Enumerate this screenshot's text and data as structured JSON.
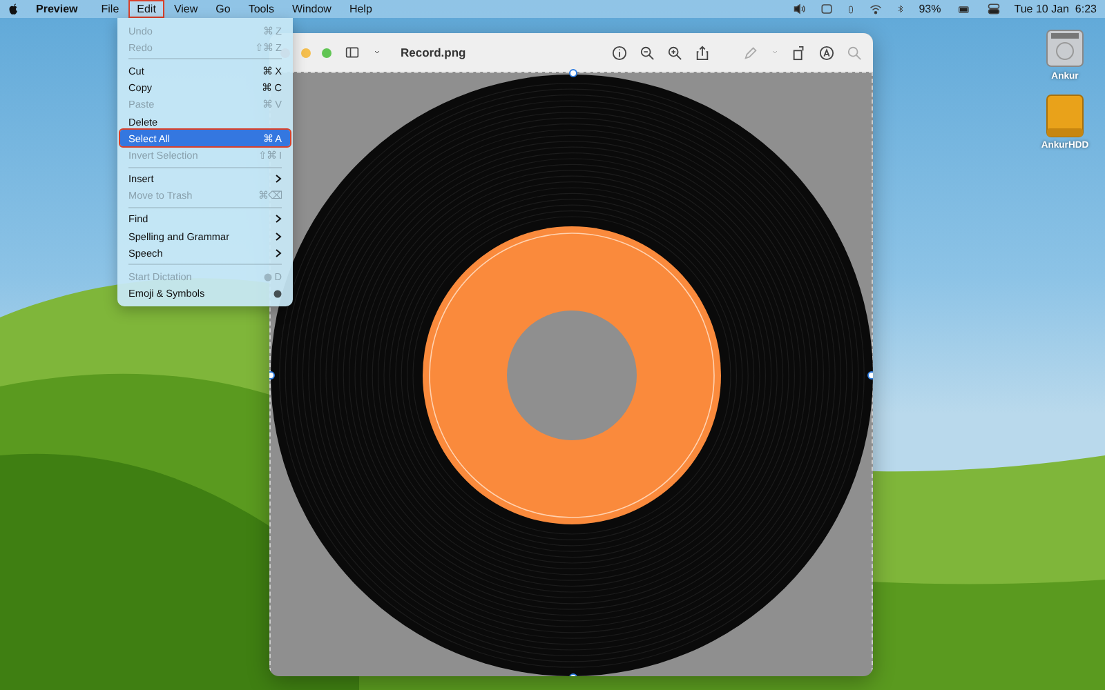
{
  "menubar": {
    "app": "Preview",
    "menus": [
      {
        "label": "File",
        "selected": false
      },
      {
        "label": "Edit",
        "selected": true
      },
      {
        "label": "View",
        "selected": false
      },
      {
        "label": "Go",
        "selected": false
      },
      {
        "label": "Tools",
        "selected": false
      },
      {
        "label": "Window",
        "selected": false
      },
      {
        "label": "Help",
        "selected": false
      }
    ],
    "battery": "93%",
    "clock": "Tue 10 Jan  6:23"
  },
  "edit_menu": [
    {
      "kind": "item",
      "label": "Undo",
      "shortcut": "⌘ Z",
      "disabled": true,
      "selected": false
    },
    {
      "kind": "item",
      "label": "Redo",
      "shortcut": "⇧⌘ Z",
      "disabled": true,
      "selected": false
    },
    {
      "kind": "separator"
    },
    {
      "kind": "item",
      "label": "Cut",
      "shortcut": "⌘ X",
      "disabled": false,
      "selected": false
    },
    {
      "kind": "item",
      "label": "Copy",
      "shortcut": "⌘ C",
      "disabled": false,
      "selected": false
    },
    {
      "kind": "item",
      "label": "Paste",
      "shortcut": "⌘ V",
      "disabled": true,
      "selected": false
    },
    {
      "kind": "item",
      "label": "Delete",
      "disabled": false,
      "selected": false
    },
    {
      "kind": "item",
      "label": "Select All",
      "shortcut": "⌘ A",
      "disabled": false,
      "selected": true
    },
    {
      "kind": "item",
      "label": "Invert Selection",
      "shortcut": "⇧⌘ I",
      "disabled": true,
      "selected": false
    },
    {
      "kind": "separator"
    },
    {
      "kind": "item",
      "label": "Insert",
      "submenu": true,
      "disabled": false,
      "selected": false
    },
    {
      "kind": "item",
      "label": "Move to Trash",
      "shortcut": "⌘⌫",
      "disabled": true,
      "selected": false
    },
    {
      "kind": "separator"
    },
    {
      "kind": "item",
      "label": "Find",
      "submenu": true,
      "disabled": false,
      "selected": false
    },
    {
      "kind": "item",
      "label": "Spelling and Grammar",
      "submenu": true,
      "disabled": false,
      "selected": false
    },
    {
      "kind": "item",
      "label": "Speech",
      "submenu": true,
      "disabled": false,
      "selected": false
    },
    {
      "kind": "separator"
    },
    {
      "kind": "item",
      "label": "Start Dictation",
      "shortcut": "D",
      "globe_key": true,
      "disabled": true,
      "selected": false
    },
    {
      "kind": "item",
      "label": "Emoji & Symbols",
      "globe_key": true,
      "disabled": false,
      "selected": false
    }
  ],
  "window": {
    "title": "Record.png"
  },
  "desktop_icons": [
    {
      "label": "Ankur",
      "kind": "disk"
    },
    {
      "label": "AnkurHDD",
      "kind": "drive"
    }
  ]
}
